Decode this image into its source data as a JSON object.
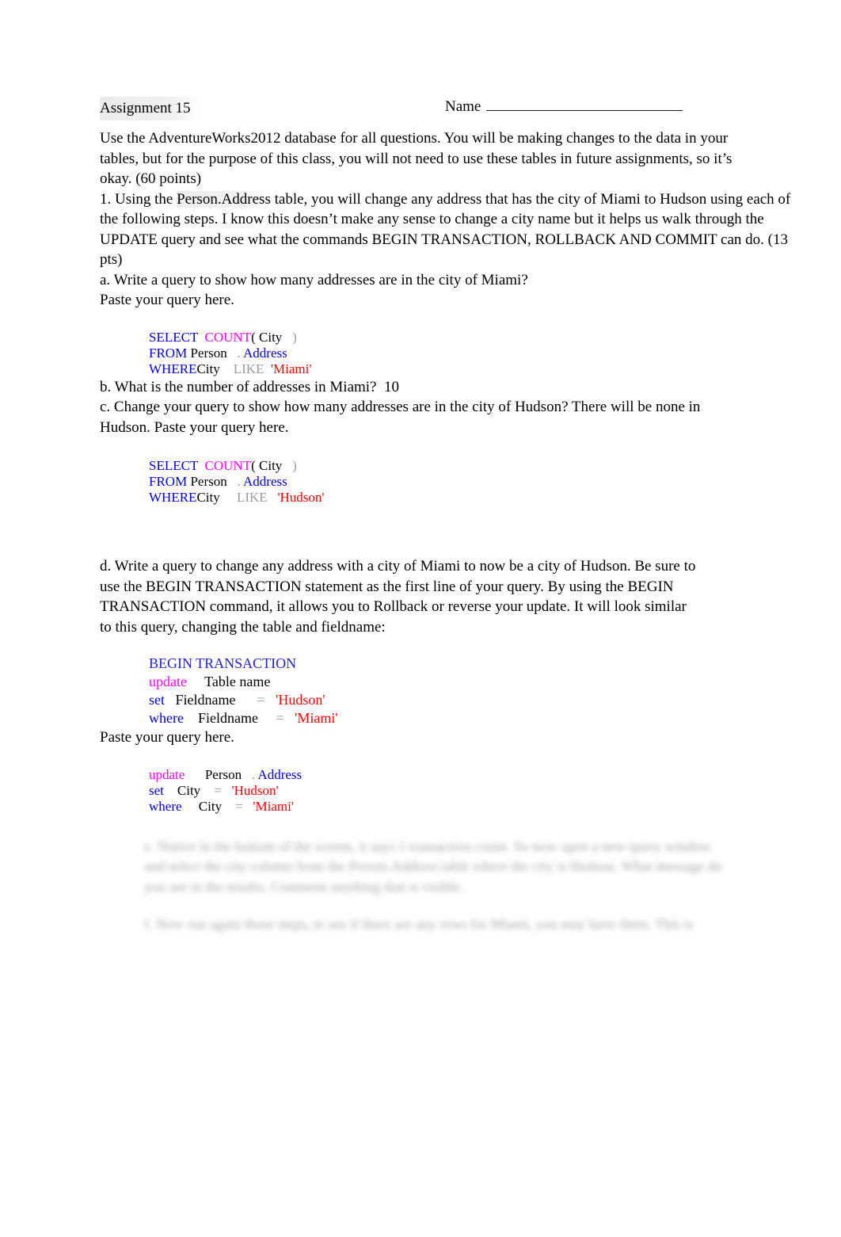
{
  "document": {
    "title": "Assignment 15",
    "name_label": "Name",
    "intro": "Use the AdventureWorks2012 database for all questions. You will be making changes to the data in your tables, but for the purpose of this class, you will not need to use these tables in future assignments, so it’s okay. (60 points)",
    "question_1": "1. Using the Person.Address table, you will change any address that has the city  of Miami to Hudson using each of the following steps. I know this doesn’t make any sense to change a city name but it helps us walk through the UPDATE query and see what the commands BEGIN TRANSACTION, ROLLBACK AND COMMIT can do. (13 pts)",
    "question_1_highlight": "Person.Address"
  },
  "items": {
    "a": {
      "prompt": "a. Write a query to show how many addresses are in the city of Miami?",
      "paste_instruction": "Paste your query here."
    },
    "b": {
      "prompt": "b. What is the number of addresses in Miami?",
      "answer": "10"
    },
    "c": {
      "prompt": "c. Change your query to show how many addresses are in the city of Hudson? There will be none in Hudson. Paste your query here."
    },
    "d": {
      "prompt": "d. Write a query to change any address with a city of Miami to now be a city of Hudson. Be sure to use the  BEGIN TRANSACTION statement as the first line of your query. By using the BEGIN TRANSACTION command, it allows you to Rollback or reverse your update. It will look similar to this query, changing the table and fieldname:",
      "paste_instruction": "Paste your query here."
    }
  },
  "code_blocks": {
    "query_a": {
      "lines": [
        [
          {
            "t": "SELECT",
            "c": "kw"
          },
          {
            "t": "  ",
            "c": "plain"
          },
          {
            "t": "COUNT",
            "c": "fn"
          },
          {
            "t": "( ",
            "c": "plain"
          },
          {
            "t": "City",
            "c": "plain"
          },
          {
            "t": "   )",
            "c": "gray"
          }
        ],
        [
          {
            "t": "FROM",
            "c": "kw"
          },
          {
            "t": " Person",
            "c": "plain"
          },
          {
            "t": "   .",
            "c": "gray"
          },
          {
            "t": " ",
            "c": "plain"
          },
          {
            "t": "Address",
            "c": "obj"
          }
        ],
        [
          {
            "t": "WHERE",
            "c": "kw"
          },
          {
            "t": "City",
            "c": "plain"
          },
          {
            "t": "    ",
            "c": "plain"
          },
          {
            "t": "LIKE",
            "c": "gray"
          },
          {
            "t": "  ",
            "c": "plain"
          },
          {
            "t": "'Miami'",
            "c": "str"
          }
        ]
      ]
    },
    "query_c": {
      "lines": [
        [
          {
            "t": "SELECT",
            "c": "kw"
          },
          {
            "t": "  ",
            "c": "plain"
          },
          {
            "t": "COUNT",
            "c": "fn"
          },
          {
            "t": "( ",
            "c": "plain"
          },
          {
            "t": "City",
            "c": "plain"
          },
          {
            "t": "   )",
            "c": "gray"
          }
        ],
        [
          {
            "t": "FROM",
            "c": "kw"
          },
          {
            "t": " Person",
            "c": "plain"
          },
          {
            "t": "   .",
            "c": "gray"
          },
          {
            "t": " ",
            "c": "plain"
          },
          {
            "t": "Address",
            "c": "obj"
          }
        ],
        [
          {
            "t": "WHERE",
            "c": "kw"
          },
          {
            "t": "City",
            "c": "plain"
          },
          {
            "t": "     ",
            "c": "plain"
          },
          {
            "t": "LIKE",
            "c": "gray"
          },
          {
            "t": "   ",
            "c": "plain"
          },
          {
            "t": "'Hudson'",
            "c": "str"
          }
        ]
      ]
    },
    "template": {
      "lines": [
        [
          {
            "t": "BEGIN TRANSACTION",
            "c": "btx"
          }
        ],
        [
          {
            "t": "update",
            "c": "fn"
          },
          {
            "t": "     Table name",
            "c": "plain"
          }
        ],
        [
          {
            "t": "set",
            "c": "kw"
          },
          {
            "t": "   Fieldname",
            "c": "plain"
          },
          {
            "t": "      ",
            "c": "plain"
          },
          {
            "t": "=",
            "c": "gray"
          },
          {
            "t": "   ",
            "c": "plain"
          },
          {
            "t": "'Hudson'",
            "c": "str"
          }
        ],
        [
          {
            "t": "where",
            "c": "kw"
          },
          {
            "t": "    Fieldname",
            "c": "plain"
          },
          {
            "t": "     ",
            "c": "plain"
          },
          {
            "t": "=",
            "c": "gray"
          },
          {
            "t": "   ",
            "c": "plain"
          },
          {
            "t": "'Miami'",
            "c": "str"
          }
        ]
      ]
    },
    "query_d": {
      "lines": [
        [
          {
            "t": "update",
            "c": "fn"
          },
          {
            "t": "      Person",
            "c": "plain"
          },
          {
            "t": "   .",
            "c": "gray"
          },
          {
            "t": " ",
            "c": "plain"
          },
          {
            "t": "Address",
            "c": "obj"
          }
        ],
        [
          {
            "t": "set",
            "c": "kw"
          },
          {
            "t": "    City",
            "c": "plain"
          },
          {
            "t": "    ",
            "c": "plain"
          },
          {
            "t": "=",
            "c": "gray"
          },
          {
            "t": "   ",
            "c": "plain"
          },
          {
            "t": "'Hudson'",
            "c": "str"
          }
        ],
        [
          {
            "t": "where",
            "c": "kw"
          },
          {
            "t": "     City",
            "c": "plain"
          },
          {
            "t": "    ",
            "c": "plain"
          },
          {
            "t": "=",
            "c": "gray"
          },
          {
            "t": "   ",
            "c": "plain"
          },
          {
            "t": "'Miami'",
            "c": "str"
          }
        ]
      ]
    }
  },
  "redacted": {
    "note": "Following content is visually blurred / illegible in the source image.",
    "block_1": "e. Notice in the bottom of the screen, it says 1 transaction count. So now open a new query window and select the city column from the Person.Address table where the city is Hudson. What message do you see in the results. Comment anything that is visible.",
    "block_2": "f. Now run again those steps, to see if there are any rows for Miami, you may have them. This is"
  },
  "colors": {
    "keyword": "#0000E6",
    "function": "#FF00FF",
    "string": "#FF0000",
    "gray": "#9a9a9a",
    "text": "#000000"
  }
}
